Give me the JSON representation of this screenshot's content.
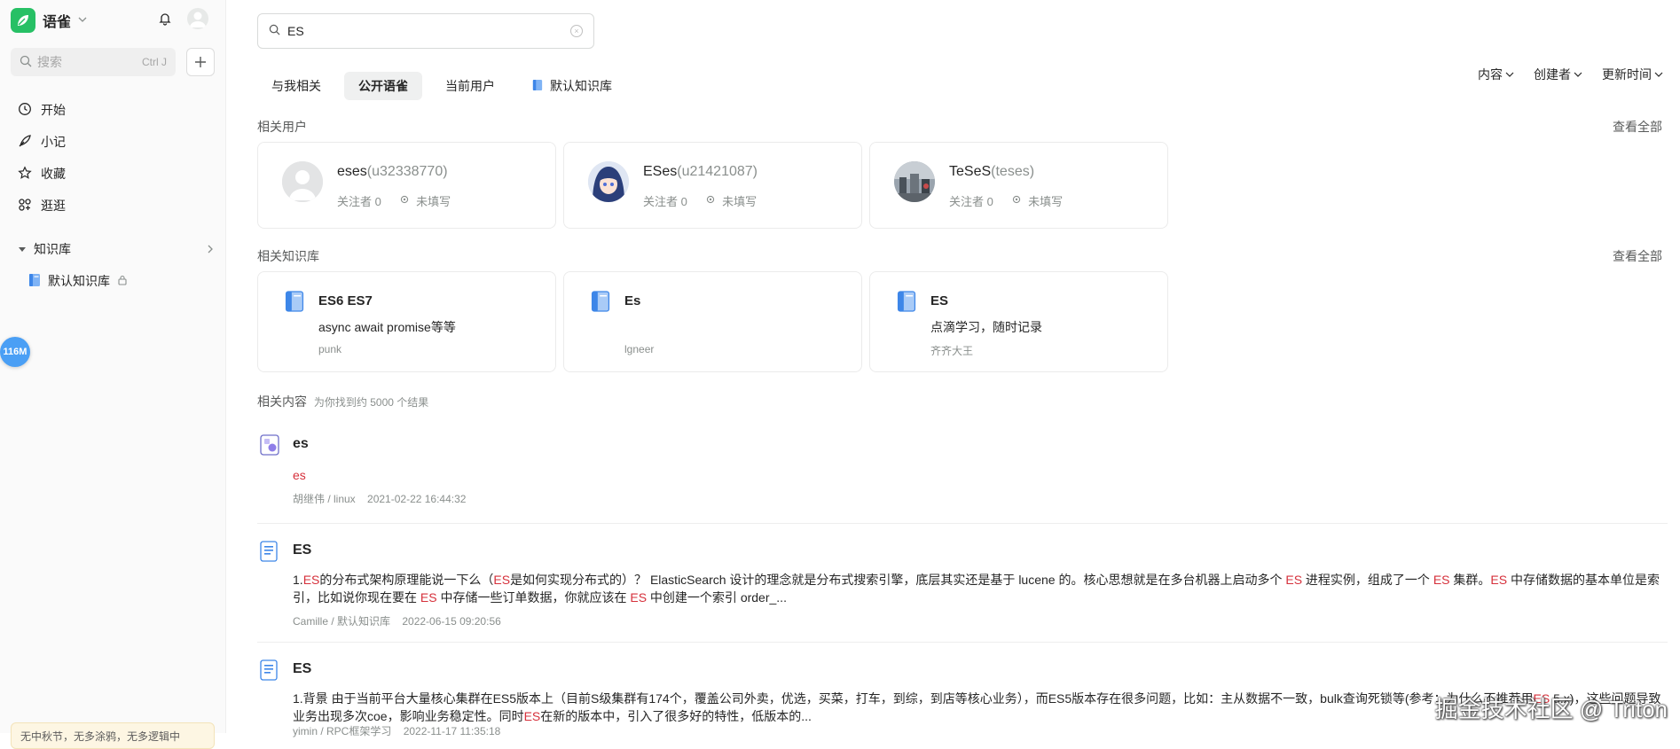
{
  "sidebar": {
    "brand": "语雀",
    "search_placeholder": "搜索",
    "search_shortcut": "Ctrl J",
    "nav": [
      {
        "label": "开始",
        "icon": "clock-icon"
      },
      {
        "label": "小记",
        "icon": "feather-icon"
      },
      {
        "label": "收藏",
        "icon": "star-icon"
      },
      {
        "label": "逛逛",
        "icon": "grid-icon"
      }
    ],
    "kb_section": "知识库",
    "kb_items": [
      {
        "label": "默认知识库"
      }
    ],
    "memory_badge": "116M",
    "notice_text": "无中秋节，无多涂鸦，无多逻辑中"
  },
  "search": {
    "query": "ES"
  },
  "tabs": [
    {
      "label": "与我相关"
    },
    {
      "label": "公开语雀",
      "active": true
    },
    {
      "label": "当前用户"
    },
    {
      "label": "默认知识库"
    }
  ],
  "filters": [
    "内容",
    "创建者",
    "更新时间"
  ],
  "users_section": {
    "title": "相关用户",
    "view_all": "查看全部"
  },
  "users": [
    {
      "name": "eses",
      "login": "(u32338770)",
      "followers": "关注者 0",
      "location": "未填写"
    },
    {
      "name": "ESes",
      "login": "(u21421087)",
      "followers": "关注者 0",
      "location": "未填写"
    },
    {
      "name": "TeSeS",
      "login": "(teses)",
      "followers": "关注者 0",
      "location": "未填写"
    }
  ],
  "kbs_section": {
    "title": "相关知识库",
    "view_all": "查看全部"
  },
  "kbs": [
    {
      "title": "ES6 ES7",
      "desc": "async await promise等等",
      "owner": "punk"
    },
    {
      "title": "Es",
      "desc": "",
      "owner": "lgneer"
    },
    {
      "title": "ES",
      "desc": "点滴学习，随时记录",
      "owner": "齐齐大王"
    }
  ],
  "content_section": {
    "title": "相关内容",
    "count": "为你找到约 5000 个结果"
  },
  "results": [
    {
      "title": "es",
      "snippet_hl": "es",
      "path": "胡继伟 / linux",
      "time": "2021-02-22 16:44:32"
    },
    {
      "title": "ES",
      "s1": "1.",
      "s2": "ES",
      "s3": "的分布式架构原理能说一下么（",
      "s4": "ES",
      "s5": "是如何实现分布式的）？ ElasticSearch 设计的理念就是分布式搜索引擎，底层其实还是基于 lucene 的。核心思想就是在多台机器上启动多个 ",
      "s6": "ES",
      "s7": " 进程实例，组成了一个 ",
      "s8": "ES",
      "s9": " 集群。",
      "s10": "ES",
      "s11": " 中存储数据的基本单位是索引，比如说你现在要在 ",
      "s12": "ES",
      "s13": " 中存储一些订单数据，你就应该在 ",
      "s14": "ES",
      "s15": " 中创建一个索引 order_...",
      "path": "Camille / 默认知识库",
      "time": "2022-06-15 09:20:56"
    },
    {
      "title": "ES",
      "s1": "1.背景 由于当前平台大量核心集群在ES5版本上（目前S级集群有174个，覆盖公司外卖，优选，买菜，打车，到综，到店等核心业务），而ES5版本存在很多问题，比如：主从数据不一致，bulk查询死锁等(参考：为什么不推荐用",
      "s2": "ES",
      "s3": " 5.x)，这些问题导致业务出现多次coe，影响业务稳定性。同时",
      "s4": "ES",
      "s5": "在新的版本中，引入了很多好的特性，低版本的...",
      "path": "yimin / RPC框架学习",
      "time": "2022-11-17 11:35:18"
    }
  ],
  "watermark": "掘金技术社区 @ Triton",
  "colors": {
    "brand": "#27c065",
    "highlight": "#d6303b",
    "badge": "#4a9ff5"
  }
}
